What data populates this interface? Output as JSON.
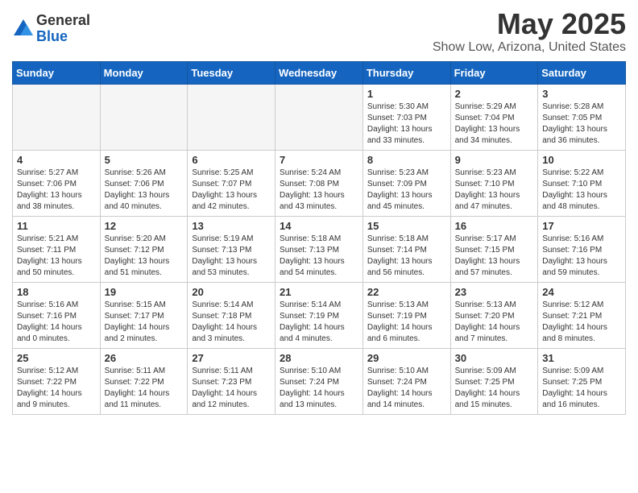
{
  "logo": {
    "general": "General",
    "blue": "Blue"
  },
  "title": "May 2025",
  "location": "Show Low, Arizona, United States",
  "weekdays": [
    "Sunday",
    "Monday",
    "Tuesday",
    "Wednesday",
    "Thursday",
    "Friday",
    "Saturday"
  ],
  "weeks": [
    [
      {
        "day": "",
        "info": ""
      },
      {
        "day": "",
        "info": ""
      },
      {
        "day": "",
        "info": ""
      },
      {
        "day": "",
        "info": ""
      },
      {
        "day": "1",
        "info": "Sunrise: 5:30 AM\nSunset: 7:03 PM\nDaylight: 13 hours\nand 33 minutes."
      },
      {
        "day": "2",
        "info": "Sunrise: 5:29 AM\nSunset: 7:04 PM\nDaylight: 13 hours\nand 34 minutes."
      },
      {
        "day": "3",
        "info": "Sunrise: 5:28 AM\nSunset: 7:05 PM\nDaylight: 13 hours\nand 36 minutes."
      }
    ],
    [
      {
        "day": "4",
        "info": "Sunrise: 5:27 AM\nSunset: 7:06 PM\nDaylight: 13 hours\nand 38 minutes."
      },
      {
        "day": "5",
        "info": "Sunrise: 5:26 AM\nSunset: 7:06 PM\nDaylight: 13 hours\nand 40 minutes."
      },
      {
        "day": "6",
        "info": "Sunrise: 5:25 AM\nSunset: 7:07 PM\nDaylight: 13 hours\nand 42 minutes."
      },
      {
        "day": "7",
        "info": "Sunrise: 5:24 AM\nSunset: 7:08 PM\nDaylight: 13 hours\nand 43 minutes."
      },
      {
        "day": "8",
        "info": "Sunrise: 5:23 AM\nSunset: 7:09 PM\nDaylight: 13 hours\nand 45 minutes."
      },
      {
        "day": "9",
        "info": "Sunrise: 5:23 AM\nSunset: 7:10 PM\nDaylight: 13 hours\nand 47 minutes."
      },
      {
        "day": "10",
        "info": "Sunrise: 5:22 AM\nSunset: 7:10 PM\nDaylight: 13 hours\nand 48 minutes."
      }
    ],
    [
      {
        "day": "11",
        "info": "Sunrise: 5:21 AM\nSunset: 7:11 PM\nDaylight: 13 hours\nand 50 minutes."
      },
      {
        "day": "12",
        "info": "Sunrise: 5:20 AM\nSunset: 7:12 PM\nDaylight: 13 hours\nand 51 minutes."
      },
      {
        "day": "13",
        "info": "Sunrise: 5:19 AM\nSunset: 7:13 PM\nDaylight: 13 hours\nand 53 minutes."
      },
      {
        "day": "14",
        "info": "Sunrise: 5:18 AM\nSunset: 7:13 PM\nDaylight: 13 hours\nand 54 minutes."
      },
      {
        "day": "15",
        "info": "Sunrise: 5:18 AM\nSunset: 7:14 PM\nDaylight: 13 hours\nand 56 minutes."
      },
      {
        "day": "16",
        "info": "Sunrise: 5:17 AM\nSunset: 7:15 PM\nDaylight: 13 hours\nand 57 minutes."
      },
      {
        "day": "17",
        "info": "Sunrise: 5:16 AM\nSunset: 7:16 PM\nDaylight: 13 hours\nand 59 minutes."
      }
    ],
    [
      {
        "day": "18",
        "info": "Sunrise: 5:16 AM\nSunset: 7:16 PM\nDaylight: 14 hours\nand 0 minutes."
      },
      {
        "day": "19",
        "info": "Sunrise: 5:15 AM\nSunset: 7:17 PM\nDaylight: 14 hours\nand 2 minutes."
      },
      {
        "day": "20",
        "info": "Sunrise: 5:14 AM\nSunset: 7:18 PM\nDaylight: 14 hours\nand 3 minutes."
      },
      {
        "day": "21",
        "info": "Sunrise: 5:14 AM\nSunset: 7:19 PM\nDaylight: 14 hours\nand 4 minutes."
      },
      {
        "day": "22",
        "info": "Sunrise: 5:13 AM\nSunset: 7:19 PM\nDaylight: 14 hours\nand 6 minutes."
      },
      {
        "day": "23",
        "info": "Sunrise: 5:13 AM\nSunset: 7:20 PM\nDaylight: 14 hours\nand 7 minutes."
      },
      {
        "day": "24",
        "info": "Sunrise: 5:12 AM\nSunset: 7:21 PM\nDaylight: 14 hours\nand 8 minutes."
      }
    ],
    [
      {
        "day": "25",
        "info": "Sunrise: 5:12 AM\nSunset: 7:22 PM\nDaylight: 14 hours\nand 9 minutes."
      },
      {
        "day": "26",
        "info": "Sunrise: 5:11 AM\nSunset: 7:22 PM\nDaylight: 14 hours\nand 11 minutes."
      },
      {
        "day": "27",
        "info": "Sunrise: 5:11 AM\nSunset: 7:23 PM\nDaylight: 14 hours\nand 12 minutes."
      },
      {
        "day": "28",
        "info": "Sunrise: 5:10 AM\nSunset: 7:24 PM\nDaylight: 14 hours\nand 13 minutes."
      },
      {
        "day": "29",
        "info": "Sunrise: 5:10 AM\nSunset: 7:24 PM\nDaylight: 14 hours\nand 14 minutes."
      },
      {
        "day": "30",
        "info": "Sunrise: 5:09 AM\nSunset: 7:25 PM\nDaylight: 14 hours\nand 15 minutes."
      },
      {
        "day": "31",
        "info": "Sunrise: 5:09 AM\nSunset: 7:25 PM\nDaylight: 14 hours\nand 16 minutes."
      }
    ]
  ]
}
